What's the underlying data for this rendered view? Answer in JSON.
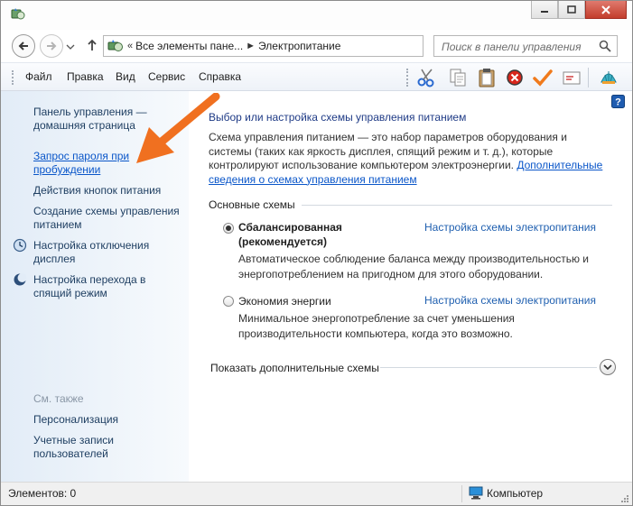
{
  "nav": {
    "address_icon": "power-options-icon",
    "breadcrumb": [
      "Все элементы пане...",
      "Электропитание"
    ],
    "search_placeholder": "Поиск в панели управления"
  },
  "menu": [
    "Файл",
    "Правка",
    "Вид",
    "Сервис",
    "Справка"
  ],
  "toolbar_icons": [
    "scissors-icon",
    "copy-icon",
    "paste-icon",
    "delete-icon",
    "check-icon",
    "properties-icon",
    "shell-icon"
  ],
  "left_pane": {
    "home_link": "Панель управления — домашняя страница",
    "links": [
      {
        "label": "Запрос пароля при пробуждении",
        "icon": "",
        "highlighted": true
      },
      {
        "label": "Действия кнопок питания",
        "icon": ""
      },
      {
        "label": "Создание схемы управления питанием",
        "icon": ""
      },
      {
        "label": "Настройка отключения дисплея",
        "icon": "clock-icon"
      },
      {
        "label": "Настройка перехода в спящий режим",
        "icon": "moon-icon"
      }
    ],
    "see_also_title": "См. также",
    "see_also": [
      "Персонализация",
      "Учетные записи пользователей"
    ]
  },
  "main": {
    "title": "Выбор или настройка схемы управления питанием",
    "description": "Схема управления питанием — это набор параметров оборудования и системы (таких как яркость дисплея, спящий режим и т. д.), которые контролируют использование компьютером электроэнергии.",
    "description_link": "Дополнительные сведения о схемах управления питанием",
    "group_title": "Основные схемы",
    "plans": [
      {
        "name": "Сбалансированная (рекомендуется)",
        "selected": true,
        "link": "Настройка схемы электропитания",
        "description": "Автоматическое соблюдение баланса между производительностью и энергопотреблением на пригодном для этого оборудовании."
      },
      {
        "name": "Экономия энергии",
        "selected": false,
        "link": "Настройка схемы электропитания",
        "description": "Минимальное энергопотребление за счет уменьшения производительности компьютера, когда это возможно."
      }
    ],
    "more_plans": "Показать дополнительные схемы"
  },
  "status": {
    "items_count": "Элементов: 0",
    "location": "Компьютер"
  },
  "colors": {
    "link": "#0a56c9",
    "title": "#1f3b86",
    "arrow": "#f07020",
    "left_pane_bg": "#e2ecf7"
  }
}
